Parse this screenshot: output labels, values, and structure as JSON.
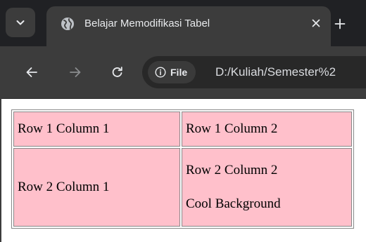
{
  "browser": {
    "tab_title": "Belajar Memodifikasi Tabel",
    "address_chip_label": "File",
    "url": "D:/Kuliah/Semester%2"
  },
  "icons": {
    "tab_search": "chevron-down-icon",
    "favicon": "globe-icon",
    "tab_close": "close-icon",
    "new_tab": "plus-icon",
    "back": "arrow-left-icon",
    "forward": "arrow-right-icon",
    "reload": "reload-icon",
    "site_info": "info-icon"
  },
  "colors": {
    "tabstrip_bg": "#202124",
    "toolbar_bg": "#3c3c3c",
    "cell_bg": "#ffc0cb",
    "cell_border": "#888888"
  },
  "table": {
    "rows": [
      [
        "Row 1 Column 1",
        "Row 1 Column 2"
      ],
      [
        "Row 2 Column 1",
        "Row 2 Column 2"
      ]
    ],
    "row2_col2_extra": "Cool Background"
  }
}
